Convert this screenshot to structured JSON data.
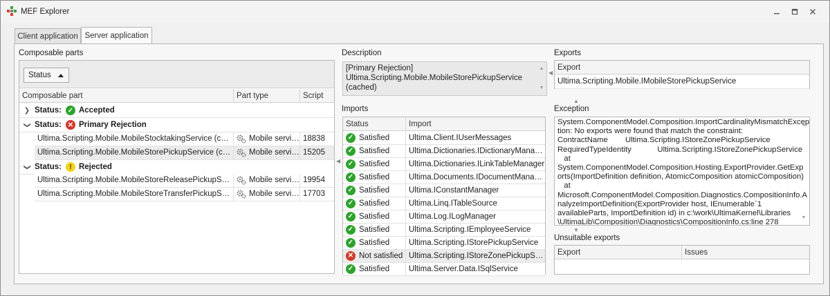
{
  "window": {
    "title": "MEF Explorer"
  },
  "tabs": [
    {
      "label": "Client application"
    },
    {
      "label": "Server application"
    }
  ],
  "composable_parts": {
    "section_label": "Composable parts",
    "groupby_label": "Status",
    "columns": [
      "Composable part",
      "Part type",
      "Script"
    ],
    "group_prefix": "Status:",
    "groups": [
      {
        "status": "Accepted",
        "icon": "check-icon",
        "rows": []
      },
      {
        "status": "Primary Rejection",
        "icon": "error-icon",
        "rows": [
          {
            "part": "Ultima.Scripting.Mobile.MobileStocktakingService (cached)",
            "type": "Mobile service",
            "script": "18838"
          },
          {
            "part": "Ultima.Scripting.Mobile.MobileStorePickupService (cached)",
            "type": "Mobile service",
            "script": "15205"
          }
        ]
      },
      {
        "status": "Rejected",
        "icon": "warning-icon",
        "rows": [
          {
            "part": "Ultima.Scripting.Mobile.MobileStoreReleasePickupService ...",
            "type": "Mobile service",
            "script": "19954"
          },
          {
            "part": "Ultima.Scripting.Mobile.MobileStoreTransferPickupService...",
            "type": "Mobile service",
            "script": "17703"
          }
        ]
      }
    ]
  },
  "description": {
    "section_label": "Description",
    "lines": [
      "[Primary Rejection]",
      "Ultima.Scripting.Mobile.MobileStorePickupService",
      "(cached)"
    ]
  },
  "imports": {
    "section_label": "Imports",
    "columns": [
      "Status",
      "Import"
    ],
    "rows": [
      {
        "status": "Satisfied",
        "import": "Ultima.Client.IUserMessages",
        "ok": true
      },
      {
        "status": "Satisfied",
        "import": "Ultima.Dictionaries.IDictionaryManager",
        "ok": true
      },
      {
        "status": "Satisfied",
        "import": "Ultima.Dictionaries.ILinkTableManager",
        "ok": true
      },
      {
        "status": "Satisfied",
        "import": "Ultima.Documents.IDocumentManager",
        "ok": true
      },
      {
        "status": "Satisfied",
        "import": "Ultima.IConstantManager",
        "ok": true
      },
      {
        "status": "Satisfied",
        "import": "Ultima.Linq.ITableSource",
        "ok": true
      },
      {
        "status": "Satisfied",
        "import": "Ultima.Log.ILogManager",
        "ok": true
      },
      {
        "status": "Satisfied",
        "import": "Ultima.Scripting.IEmployeeService",
        "ok": true
      },
      {
        "status": "Satisfied",
        "import": "Ultima.Scripting.IStorePickupService",
        "ok": true
      },
      {
        "status": "Not satisfied",
        "import": "Ultima.Scripting.IStoreZonePickupService",
        "ok": false
      },
      {
        "status": "Satisfied",
        "import": "Ultima.Server.Data.ISqlService",
        "ok": true
      }
    ]
  },
  "exports": {
    "section_label": "Exports",
    "column": "Export",
    "rows": [
      "Ultima.Scripting.Mobile.IMobileStorePickupService"
    ]
  },
  "exception": {
    "section_label": "Exception",
    "lines": [
      "System.ComponentModel.Composition.ImportCardinalityMismatchExcep",
      "tion: No exports were found that match the constraint:",
      "ContractName        Ultima.Scripting.IStoreZonePickupService",
      "RequiredTypeIdentity            Ultima.Scripting.IStoreZonePickupService",
      "   at",
      "System.ComponentModel.Composition.Hosting.ExportProvider.GetExp",
      "orts(ImportDefinition definition, AtomicComposition atomicComposition)",
      "   at",
      "Microsoft.ComponentModel.Composition.Diagnostics.CompositionInfo.A",
      "nalyzeImportDefinition(ExportProvider host, IEnumerable`1",
      "availableParts, ImportDefinition id) in c:\\work\\UltimaKernel\\Libraries",
      "\\UltimaLib\\Composition\\Diagnostics\\CompositionInfo.cs:line 278"
    ]
  },
  "unsuitable_exports": {
    "section_label": "Unsuitable exports",
    "columns": [
      "Export",
      "Issues"
    ]
  },
  "colors": {
    "ok": "#2ea32e",
    "error": "#d03a2c",
    "warning": "#f2d21a"
  }
}
